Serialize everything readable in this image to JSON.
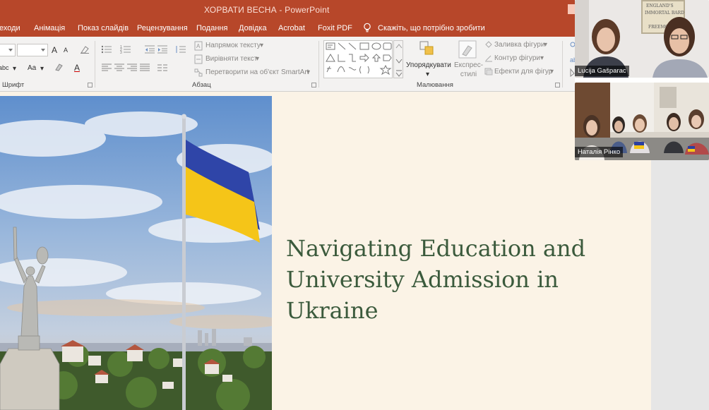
{
  "window": {
    "title": "ХОРВАТИ ВЕСНА  -  PowerPoint"
  },
  "ribbon_tabs": [
    {
      "label": "еходи"
    },
    {
      "label": "Анімація"
    },
    {
      "label": "Показ слайдів"
    },
    {
      "label": "Рецензування"
    },
    {
      "label": "Подання"
    },
    {
      "label": "Довідка"
    },
    {
      "label": "Acrobat"
    },
    {
      "label": "Foxit PDF"
    }
  ],
  "tell_me": "Скажіть, що потрібно зробити",
  "ribbon": {
    "font_group_label": "Шрифт",
    "paragraph_group_label": "Абзац",
    "drawing_group_label": "Малювання",
    "text_direction": "Напрямок тексту",
    "align_text": "Вирівняти текст",
    "smartart": "Перетворити на об'єкт SmartArt",
    "arrange": "Упорядкувати",
    "quick_styles": "Експрес-\nстилі",
    "shape_fill": "Заливка фігури",
    "shape_outline": "Контур фігури",
    "shape_effects": "Ефекти для фігур",
    "font_letters": {
      "grow": "A",
      "shrink": "A",
      "clear": "Aa",
      "color": "A",
      "strike": "abc"
    }
  },
  "slide": {
    "title_lines": [
      "Navigating Education and",
      "University Admission in",
      "Ukraine"
    ],
    "colors": {
      "background": "#fbf3e6",
      "title": "#3b5a3c",
      "flag_blue": "#2b3fa0",
      "flag_yellow": "#f5c518"
    }
  },
  "participants": [
    {
      "name": "Lucija Gašparac"
    },
    {
      "name": "Наталія Рінко"
    }
  ],
  "poster_text": [
    "ENGLAND'S",
    "IMMORTAL BARD",
    "FREEMO"
  ],
  "colors": {
    "accent": "#b7472a",
    "ribbon_bg": "#f3f2f1"
  }
}
